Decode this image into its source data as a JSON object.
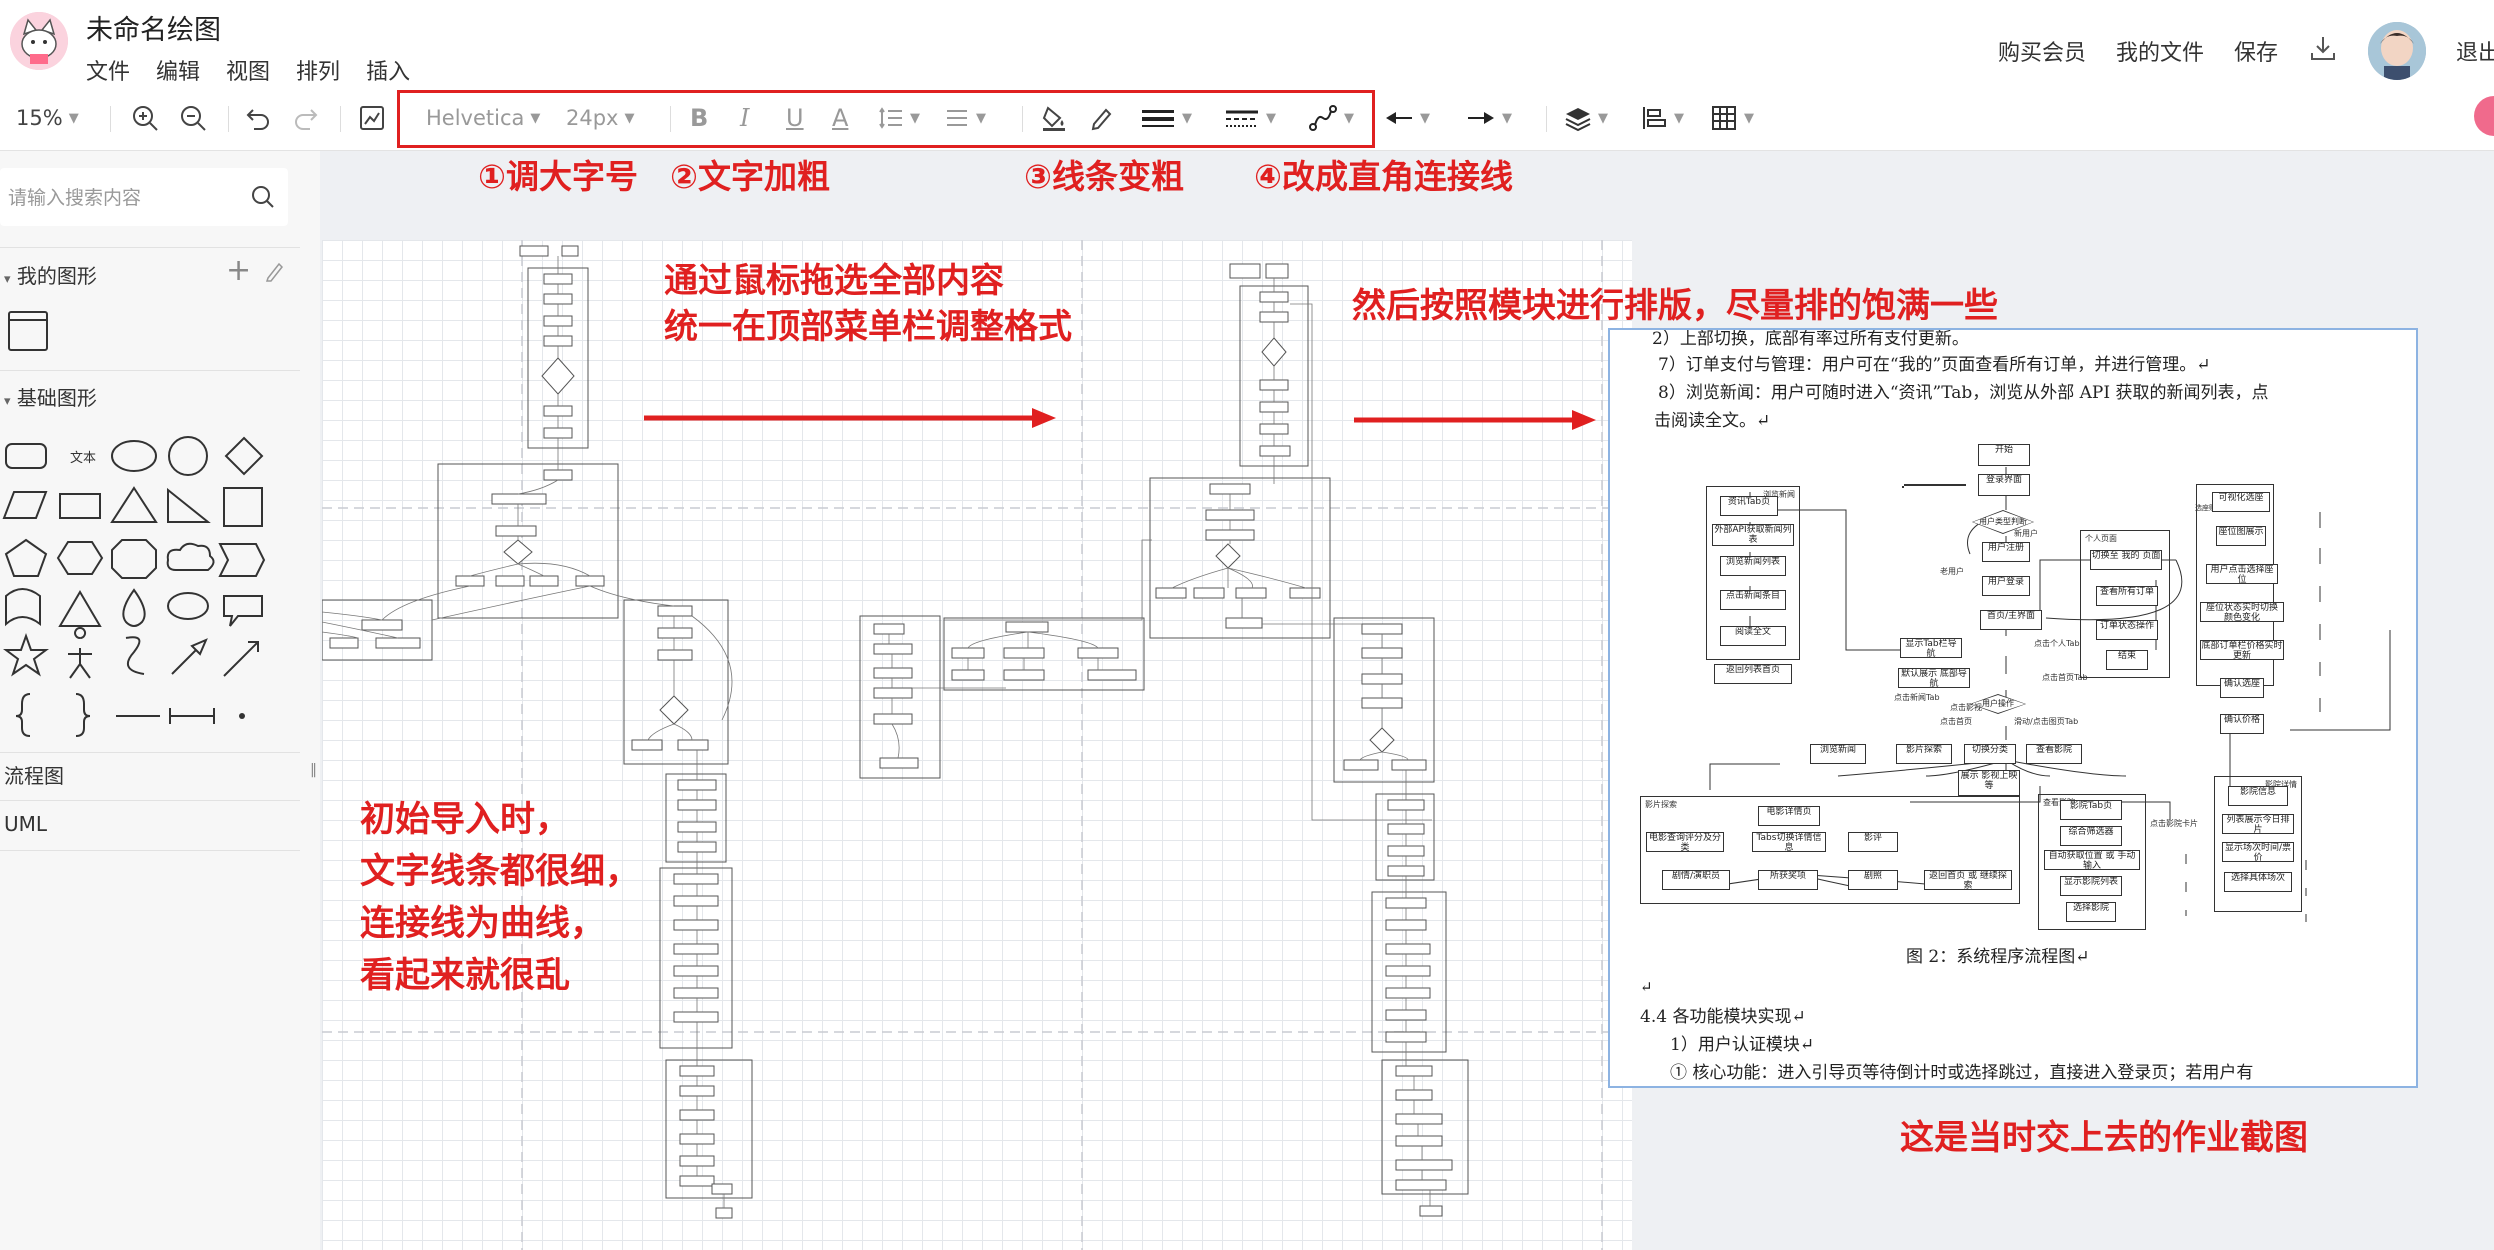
{
  "app": {
    "title": "未命名绘图",
    "logo_icon": "cat-mascot-icon"
  },
  "menu": [
    "文件",
    "编辑",
    "视图",
    "排列",
    "插入"
  ],
  "header_right": {
    "vip": "购买会员",
    "my_files": "我的文件",
    "save": "保存",
    "download_icon": "download-icon",
    "logout": "退出"
  },
  "toolbar": {
    "zoom": "15%",
    "font_family": "Helvetica",
    "font_size": "24px"
  },
  "sidebar": {
    "search_placeholder": "请输入搜索内容",
    "my_shapes": "我的图形",
    "basic_shapes": "基础图形",
    "flowchart": "流程图",
    "uml": "UML",
    "text_shape_label": "文本"
  },
  "annotations": {
    "step1": "①调大字号",
    "step2": "②文字加粗",
    "step3": "③线条变粗",
    "step4": "④改成直角连接线",
    "select_line1": "通过鼠标拖选全部内容",
    "select_line2": "统一在顶部菜单栏调整格式",
    "arrange": "然后按照模块进行排版，尽量排的饱满一些",
    "initial_line1": "初始导入时，",
    "initial_line2": "文字线条都很细，",
    "initial_line3": "连接线为曲线，",
    "initial_line4": "看起来就很乱",
    "homework": "这是当时交上去的作业截图",
    "color": "#e02020"
  },
  "homework_doc": {
    "line_top": "2）上部切换，底部有率过所有支付更新。",
    "line7": "7）订单支付与管理：用户可在“我的”页面查看所有订单，并进行管理。↵",
    "line8a": "8）浏览新闻：用户可随时进入“资讯”Tab，浏览从外部 API 获取的新闻列表，点",
    "line8b": "击阅读全文。↵",
    "caption": "图 2：系统程序流程图↵",
    "section": "4.4  各功能模块实现↵",
    "sub1": "1）用户认证模块↵",
    "core": "①  核心功能：进入引导页等待倒计时或选择跳过，直接进入登录页；若用户有",
    "flow": {
      "news_group": "浏览新闻",
      "news_nodes": [
        "资讯Tab页",
        "外部API获取新闻列表",
        "浏览新闻列表",
        "点击新闻条目",
        "阅读全文",
        "返回列表首页"
      ],
      "center_nodes": [
        "开始",
        "登录界面",
        "用户类型判断",
        "用户注册",
        "用户登录",
        "首页/主界面",
        "显示Tab栏导航",
        "默认展示 底部导航",
        "用户操作"
      ],
      "center_labels": [
        "新用户",
        "老用户",
        "点击个人Tab",
        "点击首页Tab",
        "点击新闻Tab",
        "点击影视",
        "点击首页",
        "滑动/点击图页Tab"
      ],
      "personal_group": "个人页面",
      "personal_nodes": [
        "切换至 我的 页面",
        "查看所有订单",
        "订单状态操作",
        "结束"
      ],
      "seat_group": "选座购票流程",
      "seat_nodes": [
        "可视化选座",
        "座位图展示",
        "用户点击选择座位",
        "座位状态实时切换 颜色变化",
        "底部订单栏价格实时更新",
        "确认选座",
        "确认价格"
      ],
      "bottom_nodes": [
        "浏览新闻",
        "影片探索",
        "切换分类",
        "展示 影视上映等",
        "查看影院"
      ],
      "film_group": "影片探索",
      "film_nodes": [
        "电影详情页",
        "电影查询评分及分类",
        "Tabs切换详情信息",
        "影评",
        "剧情/演职员",
        "所获奖项",
        "剧照",
        "返回首页 或 继续探索"
      ],
      "cinema_group": "查看影院",
      "cinema_nodes": [
        "影院Tab页",
        "综合筛选器",
        "自动获取位置 或 手动输入",
        "显示影院列表",
        "选择影院"
      ],
      "schedule_group": "影院详情",
      "schedule_nodes": [
        "影院信息",
        "列表展示今日排片",
        "显示场次时间/票价",
        "选择具体场次"
      ],
      "schedule_label": "点击影院卡片"
    }
  }
}
